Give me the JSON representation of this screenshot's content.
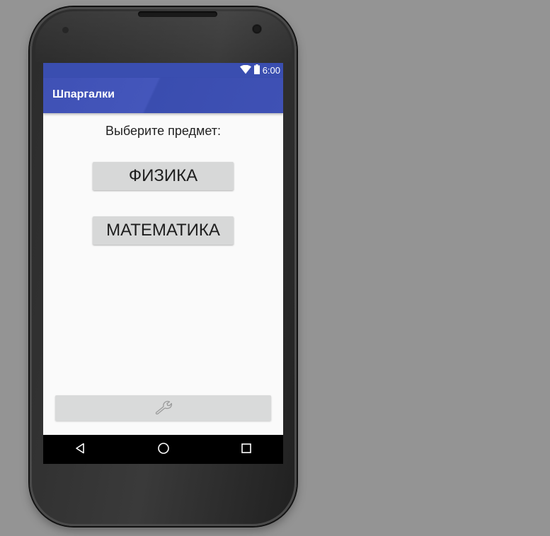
{
  "status_bar": {
    "time": "6:00",
    "icons": [
      "wifi-icon",
      "battery-icon"
    ]
  },
  "app_bar": {
    "title": "Шпаргалки"
  },
  "main": {
    "prompt": "Выберите предмет:",
    "buttons": [
      {
        "label": "ФИЗИКА"
      },
      {
        "label": "МАТЕМАТИКА"
      }
    ],
    "settings_button": {
      "icon": "wrench-icon"
    }
  },
  "nav_bar": {
    "icons": [
      "back-icon",
      "home-icon",
      "recent-apps-icon"
    ]
  },
  "colors": {
    "primary": "#3f51b5",
    "primary_dark": "#3a4eb0",
    "button_bg": "#d7d8d8",
    "screen_bg": "#fafafa",
    "backdrop": "#949494"
  }
}
